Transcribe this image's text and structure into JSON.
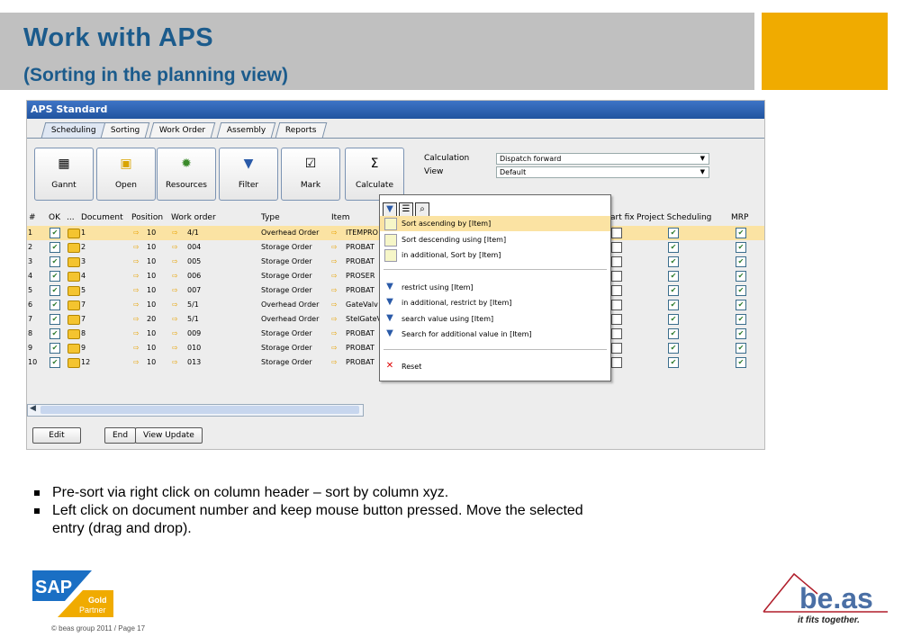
{
  "slide": {
    "title": "Work with APS",
    "subtitle": "(Sorting in the planning view)"
  },
  "app": {
    "title": "APS Standard",
    "tabs": [
      "Scheduling",
      "Sorting",
      "Work Order",
      "Assembly",
      "Reports"
    ],
    "toolbar": [
      {
        "label": "Gannt",
        "icon": "gantt-icon"
      },
      {
        "label": "Open",
        "icon": "folder-icon"
      },
      {
        "label": "Resources",
        "icon": "gear-icon"
      },
      {
        "label": "Filter",
        "icon": "funnel-icon"
      },
      {
        "label": "Mark",
        "icon": "mark-icon"
      },
      {
        "label": "Calculate",
        "icon": "sigma-icon"
      }
    ],
    "calculation_label": "Calculation",
    "calculation_value": "Dispatch forward",
    "view_label": "View",
    "view_value": "Default",
    "columns": {
      "num": "#",
      "ok": "OK",
      "dots": "...",
      "document": "Document",
      "position": "Position",
      "work_order": "Work order",
      "type": "Type",
      "item": "Item",
      "start_fix": "art fix",
      "project_scheduling": "Project Scheduling",
      "mrp": "MRP"
    },
    "rows": [
      {
        "num": "1",
        "document": "1",
        "position": "10",
        "work_order": "4/1",
        "type": "Overhead Order",
        "item": "ITEMPRO"
      },
      {
        "num": "2",
        "document": "2",
        "position": "10",
        "work_order": "004",
        "type": "Storage Order",
        "item": "PROBAT"
      },
      {
        "num": "3",
        "document": "3",
        "position": "10",
        "work_order": "005",
        "type": "Storage Order",
        "item": "PROBAT"
      },
      {
        "num": "4",
        "document": "4",
        "position": "10",
        "work_order": "006",
        "type": "Storage Order",
        "item": "PROSER"
      },
      {
        "num": "5",
        "document": "5",
        "position": "10",
        "work_order": "007",
        "type": "Storage Order",
        "item": "PROBAT"
      },
      {
        "num": "6",
        "document": "7",
        "position": "10",
        "work_order": "5/1",
        "type": "Overhead Order",
        "item": "GateValv"
      },
      {
        "num": "7",
        "document": "7",
        "position": "20",
        "work_order": "5/1",
        "type": "Overhead Order",
        "item": "StelGateV"
      },
      {
        "num": "8",
        "document": "8",
        "position": "10",
        "work_order": "009",
        "type": "Storage Order",
        "item": "PROBAT"
      },
      {
        "num": "9",
        "document": "9",
        "position": "10",
        "work_order": "010",
        "type": "Storage Order",
        "item": "PROBAT"
      },
      {
        "num": "10",
        "document": "12",
        "position": "10",
        "work_order": "013",
        "type": "Storage Order",
        "item": "PROBAT"
      }
    ],
    "buttons": {
      "edit": "Edit",
      "end": "End",
      "view_update": "View Update"
    },
    "context_menu": {
      "items": [
        {
          "label": "Sort ascending by [Item]",
          "icon": "sort-icon"
        },
        {
          "label": "Sort descending using [Item]",
          "icon": "sort-icon"
        },
        {
          "label": "in additional, Sort by [Item]",
          "icon": "sort-icon"
        },
        {
          "label": "restrict using [Item]",
          "icon": "funnel-icon"
        },
        {
          "label": "in additional, restrict by [Item]",
          "icon": "funnel-icon"
        },
        {
          "label": "search value using [Item]",
          "icon": "funnel-icon"
        },
        {
          "label": "Search for additional value in [Item]",
          "icon": "funnel-icon"
        },
        {
          "label": "Reset",
          "icon": "close-icon"
        }
      ]
    }
  },
  "bullets": [
    "Pre-sort via right click on column header – sort by column xyz.",
    "Left click on document number and keep mouse button pressed. Move the selected entry (drag and drop)."
  ],
  "footer": {
    "sap_logo_text": "SAP",
    "sap_badge_line1": "Gold",
    "sap_badge_line2": "Partner",
    "copyright": "© beas group 2011 / Page 17",
    "beas_logo_text": "be.as",
    "beas_tagline": "it fits together."
  },
  "colors": {
    "title_blue": "#1b5b8c",
    "accent_orange": "#f0ab00",
    "selection": "#fbe3a3",
    "app_titlebar": "#2a5fae"
  }
}
